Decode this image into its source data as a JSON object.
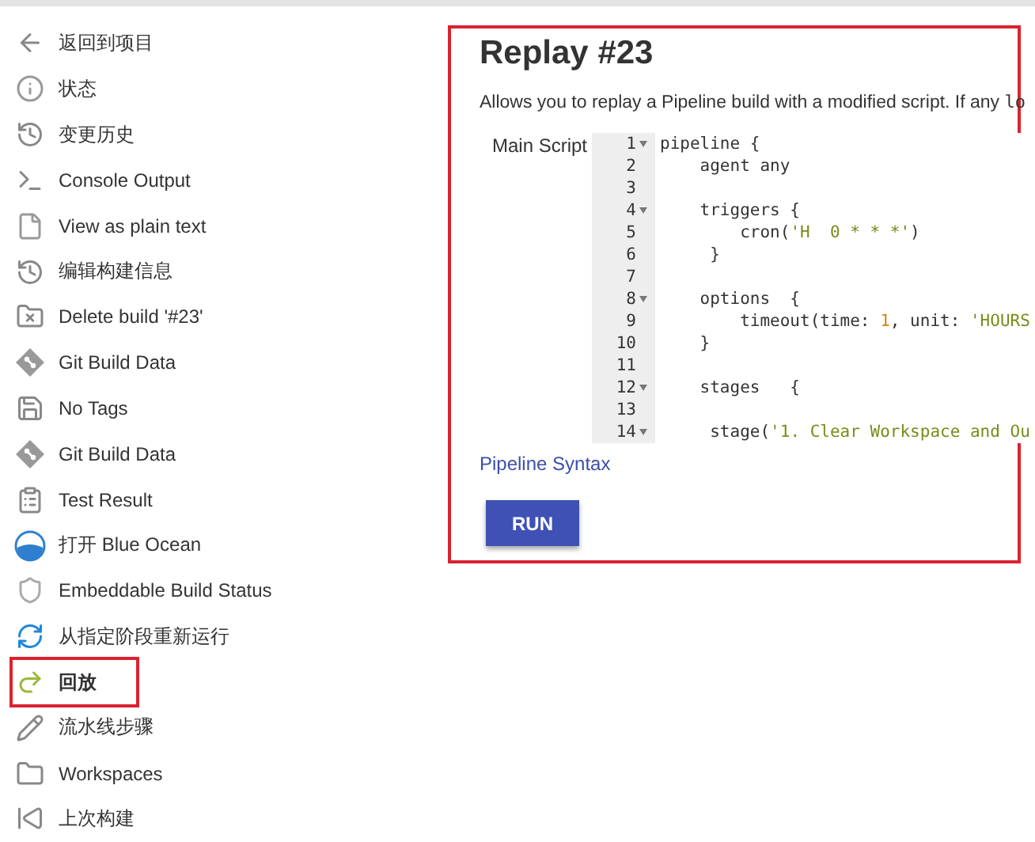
{
  "sidebar": {
    "items": [
      {
        "label": "返回到项目",
        "selected": false,
        "highlighted": false
      },
      {
        "label": "状态",
        "selected": false,
        "highlighted": false
      },
      {
        "label": "变更历史",
        "selected": false,
        "highlighted": false
      },
      {
        "label": "Console Output",
        "selected": false,
        "highlighted": false
      },
      {
        "label": "View as plain text",
        "selected": false,
        "highlighted": false
      },
      {
        "label": "编辑构建信息",
        "selected": false,
        "highlighted": false
      },
      {
        "label": "Delete build '#23'",
        "selected": false,
        "highlighted": false
      },
      {
        "label": "Git Build Data",
        "selected": false,
        "highlighted": false
      },
      {
        "label": "No Tags",
        "selected": false,
        "highlighted": false
      },
      {
        "label": "Git Build Data",
        "selected": false,
        "highlighted": false
      },
      {
        "label": "Test Result",
        "selected": false,
        "highlighted": false
      },
      {
        "label": "打开 Blue Ocean",
        "selected": false,
        "highlighted": false
      },
      {
        "label": "Embeddable Build Status",
        "selected": false,
        "highlighted": false
      },
      {
        "label": "从指定阶段重新运行",
        "selected": false,
        "highlighted": false
      },
      {
        "label": "回放",
        "selected": true,
        "highlighted": true
      },
      {
        "label": "流水线步骤",
        "selected": false,
        "highlighted": false
      },
      {
        "label": "Workspaces",
        "selected": false,
        "highlighted": false
      },
      {
        "label": "上次构建",
        "selected": false,
        "highlighted": false
      }
    ]
  },
  "main": {
    "highlighted": true,
    "title": "Replay #23",
    "description": "Allows you to replay a Pipeline build with a modified script. If any",
    "description_code": "lo",
    "script_label": "Main Script",
    "script_lines": [
      {
        "number": "1",
        "fold": true,
        "segments": [
          {
            "kind": "plain",
            "text": "pipeline {"
          }
        ]
      },
      {
        "number": "2",
        "fold": false,
        "segments": [
          {
            "kind": "plain",
            "text": "    agent any"
          }
        ]
      },
      {
        "number": "3",
        "fold": false
      },
      {
        "number": "4",
        "fold": true,
        "segments": [
          {
            "kind": "plain",
            "text": "    triggers {"
          }
        ]
      },
      {
        "number": "5",
        "fold": false,
        "segments": [
          {
            "kind": "plain",
            "text": "        cron("
          },
          {
            "kind": "string",
            "text": "'H  0 * * *'"
          },
          {
            "kind": "plain",
            "text": ")"
          }
        ]
      },
      {
        "number": "6",
        "fold": false,
        "segments": [
          {
            "kind": "plain",
            "text": "     }"
          }
        ]
      },
      {
        "number": "7",
        "fold": false
      },
      {
        "number": "8",
        "fold": true,
        "segments": [
          {
            "kind": "plain",
            "text": "    options  {"
          }
        ]
      },
      {
        "number": "9",
        "fold": false,
        "segments": [
          {
            "kind": "plain",
            "text": "        timeout(time: "
          },
          {
            "kind": "number",
            "text": "1"
          },
          {
            "kind": "plain",
            "text": ", unit: "
          },
          {
            "kind": "string",
            "text": "'HOURS"
          }
        ]
      },
      {
        "number": "10",
        "fold": false,
        "segments": [
          {
            "kind": "plain",
            "text": "    }"
          }
        ]
      },
      {
        "number": "11",
        "fold": false
      },
      {
        "number": "12",
        "fold": true,
        "segments": [
          {
            "kind": "plain",
            "text": "    stages   {"
          }
        ]
      },
      {
        "number": "13",
        "fold": false
      },
      {
        "number": "14",
        "fold": true,
        "segments": [
          {
            "kind": "plain",
            "text": "     stage("
          },
          {
            "kind": "string",
            "text": "'1. Clear Workspace and Ou"
          }
        ]
      }
    ],
    "syntax_link": "Pipeline Syntax",
    "run_button": "RUN"
  }
}
